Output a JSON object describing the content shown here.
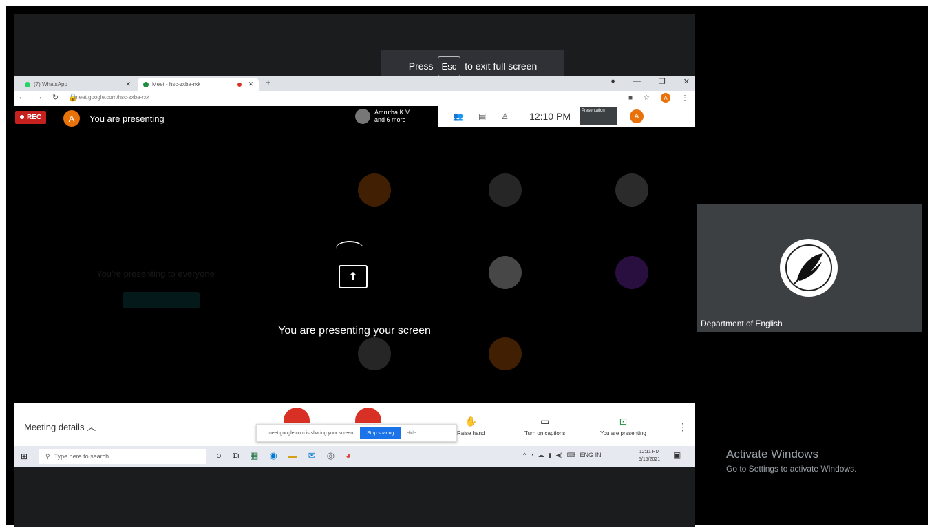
{
  "fullscreen_toast": {
    "press": "Press",
    "key": "Esc",
    "rest": "to exit full screen"
  },
  "browser": {
    "tabs": [
      {
        "label": "(7) WhatsApp",
        "dot_color": "#25d366"
      },
      {
        "label": "Meet - hsc-zxba-rxk",
        "dot_color": "#1e8e3e"
      }
    ],
    "new_tab": "+",
    "url": "meet.google.com/hsc-zxba-rxk"
  },
  "meet": {
    "rec_label": "REC",
    "avatar_letter": "A",
    "presenting_label": "You are presenting",
    "participants_line1": "Amrutha K V",
    "participants_line2": "and 6 more",
    "clock": "12:10 PM",
    "presentation_thumb_label": "Presentation",
    "center_message": "You are presenting your screen",
    "background_message": "You're presenting to everyone"
  },
  "meetbar": {
    "meeting_details": "Meeting details",
    "share_banner_text": "meet.google.com is sharing your screen.",
    "stop_sharing": "Stop sharing",
    "hide": "Hide",
    "raise_hand": "Raise hand",
    "captions": "Turn on captions",
    "you_presenting": "You are presenting"
  },
  "taskbar": {
    "search_placeholder": "Type here to search",
    "lang": "ENG",
    "lang2": "IN",
    "time": "12:11 PM",
    "date": "5/15/2021"
  },
  "side_tile": {
    "name": "Department of English"
  },
  "watermark": {
    "title": "Activate Windows",
    "subtitle": "Go to Settings to activate Windows."
  }
}
